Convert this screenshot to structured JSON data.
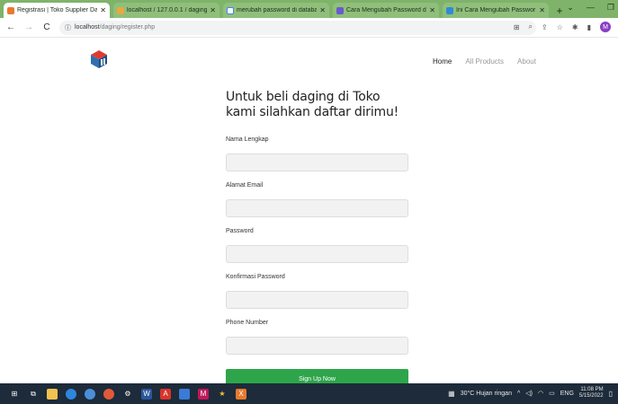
{
  "browser": {
    "tabs": [
      {
        "title": "Registrasi | Toko Supplier Dag",
        "color": "#e8792e",
        "active": true
      },
      {
        "title": "localhost / 127.0.0.1 / daging",
        "color": "#e9a840",
        "active": false
      },
      {
        "title": "merubah password di databa",
        "color": "#ffffff",
        "active": false
      },
      {
        "title": "Cara Mengubah Password di",
        "color": "#6a5acd",
        "active": false
      },
      {
        "title": "Ini Cara Mengubah Passwor",
        "color": "#2e8bd6",
        "active": false
      }
    ],
    "new_tab": "+",
    "url_host": "localhost",
    "url_path": "/daging/register.php"
  },
  "site": {
    "nav": {
      "home": "Home",
      "all_products": "All Products",
      "about": "About"
    }
  },
  "form": {
    "heading": "Untuk beli daging di Toko kami silahkan daftar dirimu!",
    "fields": {
      "full_name_label": "Nama Lengkap",
      "email_label": "Alamat Email",
      "password_label": "Password",
      "confirm_label": "Konfirmasi Password",
      "phone_label": "Phone Number"
    },
    "submit_label": "Sign Up Now"
  },
  "taskbar": {
    "weather": "30°C Hujan ringan",
    "language": "ENG",
    "time": "11:08 PM",
    "date": "5/15/2022"
  },
  "colors": {
    "accent_green": "#2ea54a",
    "tab_strip": "#7fb36a",
    "taskbar": "#1d2b3a"
  }
}
